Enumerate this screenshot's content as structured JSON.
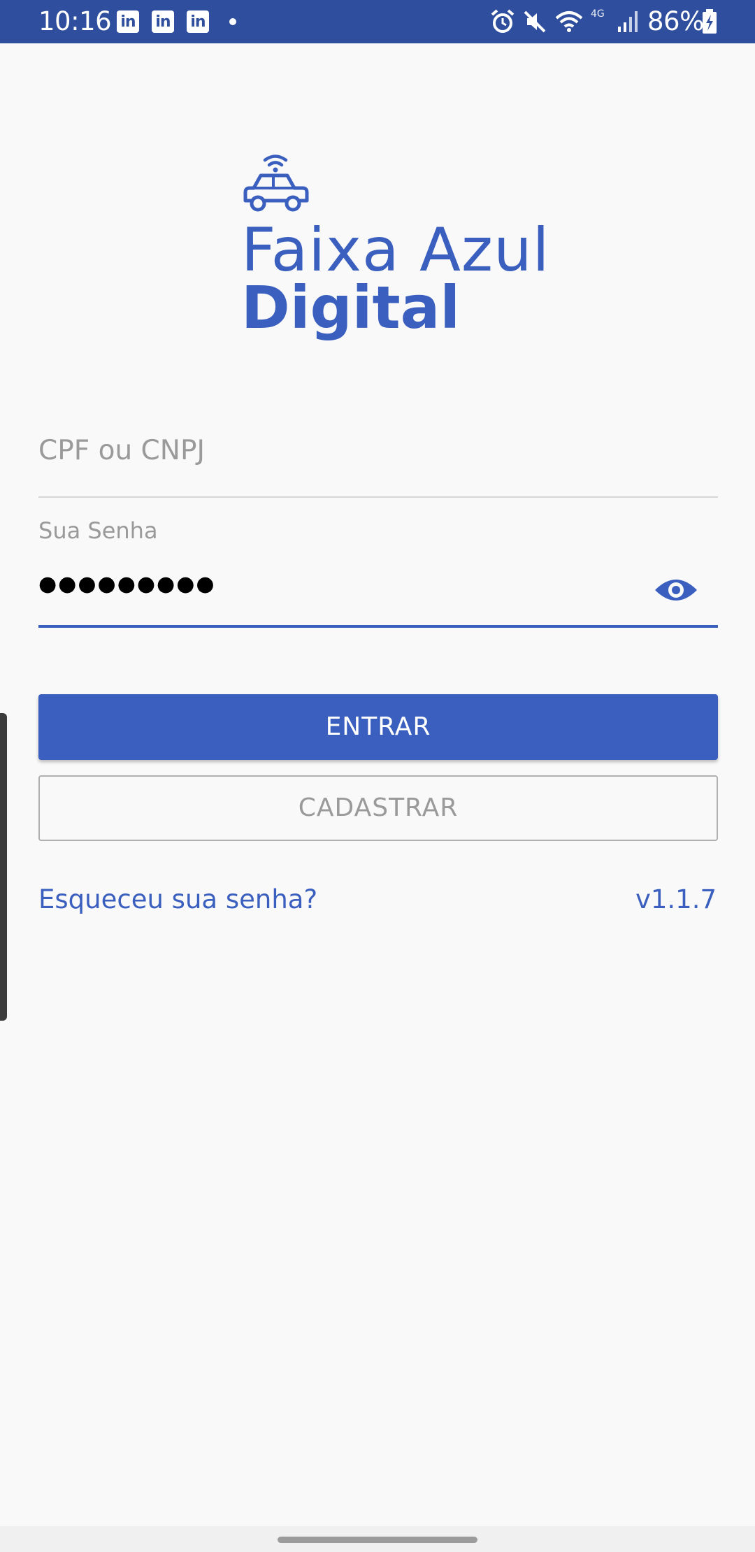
{
  "status_bar": {
    "time": "10:16",
    "notification_icons": [
      "linkedin-icon",
      "linkedin-icon",
      "linkedin-icon"
    ],
    "network_label": "4G",
    "battery_percent": "86%"
  },
  "logo": {
    "line1": "Faixa Azul",
    "line2": "Digital"
  },
  "login_form": {
    "cpf_placeholder": "CPF ou CNPJ",
    "password_label": "Sua Senha",
    "password_value": "●●●●●●●●●"
  },
  "buttons": {
    "entrar": "ENTRAR",
    "cadastrar": "CADASTRAR"
  },
  "footer": {
    "forgot_password": "Esqueceu sua senha?",
    "version": "v1.1.7"
  },
  "colors": {
    "brand_blue": "#3a5fbf",
    "status_bar": "#2f4f9e",
    "background": "#f9f9f9"
  }
}
